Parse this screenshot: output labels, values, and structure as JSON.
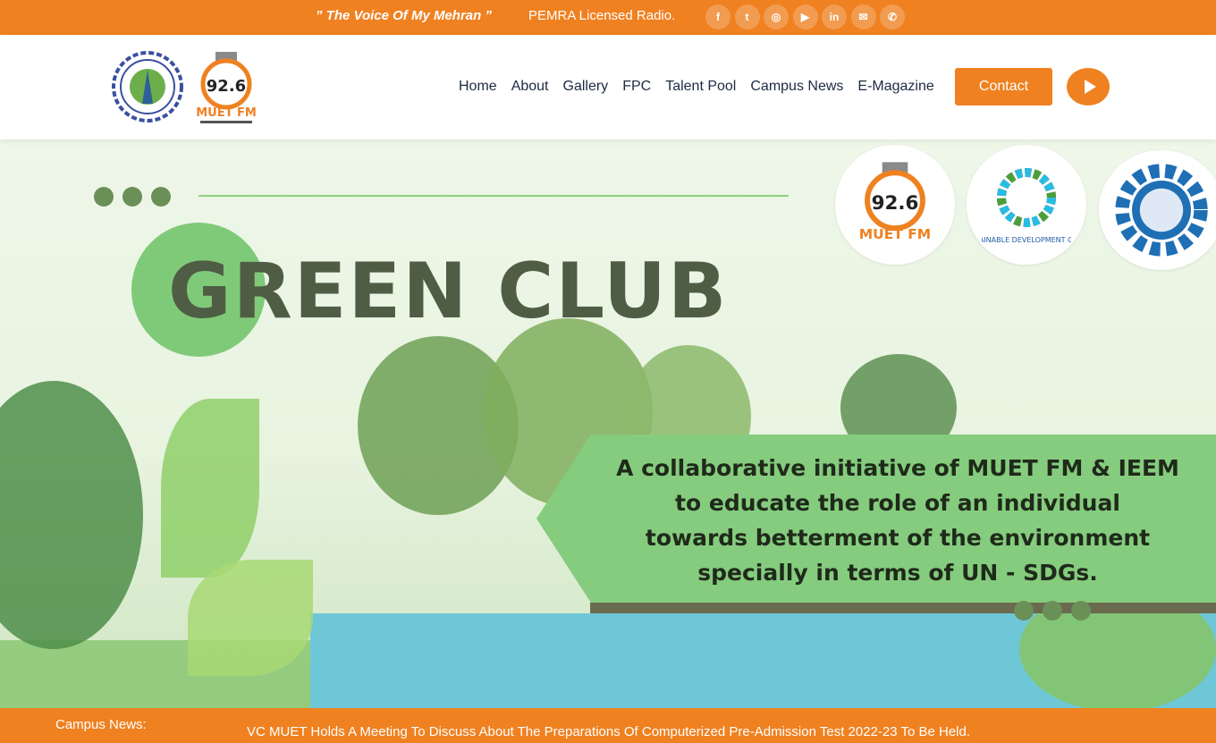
{
  "topbar": {
    "tagline": "” The Voice Of My Mehran ”",
    "licensed": "PEMRA Licensed Radio.",
    "socials": [
      {
        "name": "facebook-icon",
        "glyph": "f"
      },
      {
        "name": "twitter-icon",
        "glyph": "t"
      },
      {
        "name": "instagram-icon",
        "glyph": "◎"
      },
      {
        "name": "youtube-icon",
        "glyph": "▶"
      },
      {
        "name": "linkedin-icon",
        "glyph": "in"
      },
      {
        "name": "email-icon",
        "glyph": "✉"
      },
      {
        "name": "phone-icon",
        "glyph": "✆"
      }
    ]
  },
  "header": {
    "fm_logo_text": "92.6",
    "fm_logo_sub": "MUET FM",
    "nav": [
      "Home",
      "About",
      "Gallery",
      "FPC",
      "Talent Pool",
      "Campus News",
      "E-Magazine"
    ],
    "contact_label": "Contact"
  },
  "hero": {
    "title": "GREEN CLUB",
    "partners": [
      "MUET FM",
      "SUSTAINABLE DEVELOPMENT GOALS",
      "IEEM"
    ],
    "banner_lines": [
      "A collaborative initiative of MUET FM & IEEM",
      "to educate the role of an individual",
      "towards betterment of the environment",
      "specially in terms of UN - SDGs."
    ]
  },
  "ticker": {
    "label": "Campus News:",
    "text": "VC MUET Holds A Meeting To Discuss About The Preparations Of Computerized Pre-Admission Test 2022-23 To Be Held."
  },
  "colors": {
    "accent": "#ef8121",
    "green": "#85cc7e",
    "dark_text": "#1d2a44"
  }
}
